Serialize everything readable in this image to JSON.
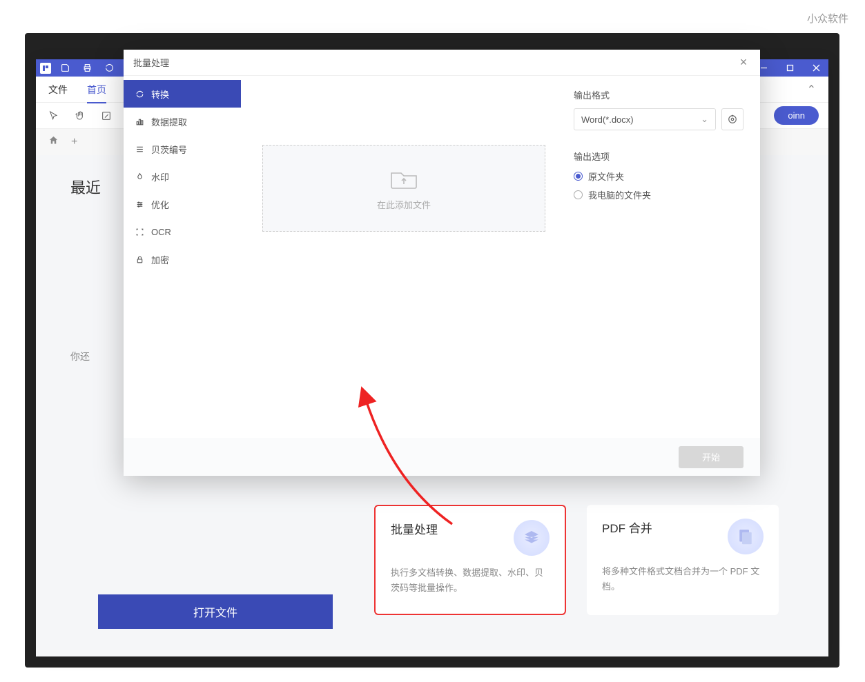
{
  "watermark": "小众软件",
  "menubar": {
    "file": "文件",
    "home": "首页"
  },
  "oinn": "oinn",
  "recent": {
    "title": "最近",
    "empty": "你还"
  },
  "open_button": "打开文件",
  "cards": {
    "batch": {
      "title": "批量处理",
      "desc": "执行多文档转换、数据提取、水印、贝茨码等批量操作。"
    },
    "merge": {
      "title": "PDF 合并",
      "desc": "将多种文件格式文档合并为一个 PDF 文档。"
    }
  },
  "dialog": {
    "title": "批量处理",
    "sidebar": {
      "convert": "转换",
      "extract": "数据提取",
      "bates": "贝茨编号",
      "watermark": "水印",
      "optimize": "优化",
      "ocr": "OCR",
      "encrypt": "加密"
    },
    "dropzone": "在此添加文件",
    "output_format_label": "输出格式",
    "output_format_value": "Word(*.docx)",
    "output_option_label": "输出选项",
    "option_original": "原文件夹",
    "option_computer": "我电脑的文件夹",
    "start": "开始"
  }
}
